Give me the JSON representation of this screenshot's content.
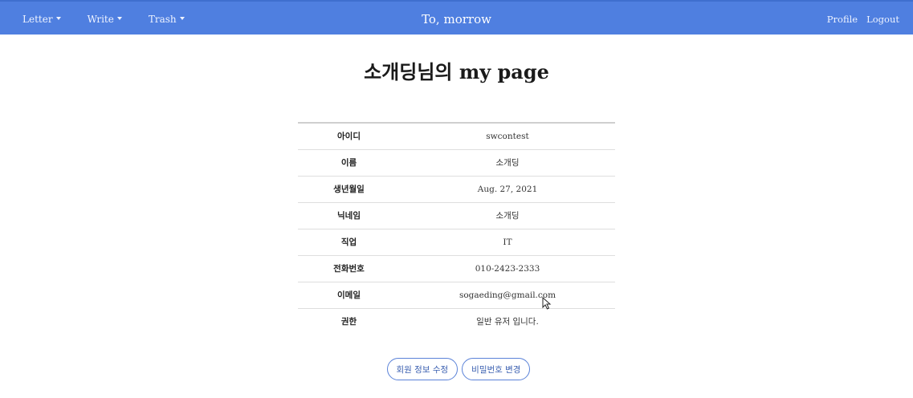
{
  "nav": {
    "menus": [
      "Letter",
      "Write",
      "Trash"
    ],
    "brand": "To, morrow",
    "profile": "Profile",
    "logout": "Logout"
  },
  "page": {
    "title": "소개딩님의 my page"
  },
  "profile_rows": [
    {
      "label": "아이디",
      "value": "swcontest"
    },
    {
      "label": "이름",
      "value": "소개딩"
    },
    {
      "label": "생년월일",
      "value": "Aug. 27, 2021"
    },
    {
      "label": "닉네임",
      "value": "소개딩"
    },
    {
      "label": "직업",
      "value": "IT"
    },
    {
      "label": "전화번호",
      "value": "010-2423-2333"
    },
    {
      "label": "이메일",
      "value": "sogaeding@gmail.com"
    },
    {
      "label": "권한",
      "value": "일반 유저 입니다."
    }
  ],
  "buttons": {
    "edit_profile": "회원 정보 수정",
    "change_password": "비밀번호 변경"
  },
  "colors": {
    "navbar": "#4f7fe0",
    "button_border": "#5a82d8"
  }
}
